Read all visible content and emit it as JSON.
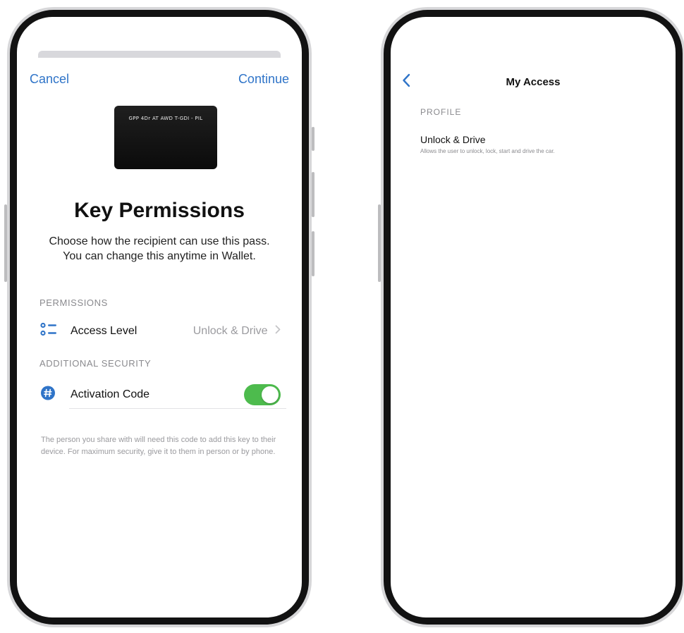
{
  "left_screen": {
    "nav": {
      "cancel_label": "Cancel",
      "continue_label": "Continue"
    },
    "card": {
      "text": "GPP 4Dr AT AWD T-GDI - PIL"
    },
    "title": "Key Permissions",
    "subtitle_line1": "Choose how the recipient can use this pass.",
    "subtitle_line2": "You can change this anytime in Wallet.",
    "permissions": {
      "section_label": "PERMISSIONS",
      "row_label": "Access Level",
      "row_value": "Unlock & Drive",
      "row_icon": "list-icon"
    },
    "security": {
      "section_label": "ADDITIONAL SECURITY",
      "row_label": "Activation Code",
      "row_icon": "hash-icon",
      "toggle_on": true
    },
    "footer": "The person you share with will need this code to add this key to their device. For maximum security, give it to them in person or by phone."
  },
  "right_screen": {
    "nav_title": "My Access",
    "back_icon": "chevron-left-icon",
    "section_label": "PROFILE",
    "item_title": "Unlock & Drive",
    "item_description": "Allows the user to unlock, lock, start and drive the car."
  },
  "colors": {
    "accent": "#2f74c8",
    "toggle_on": "#4dbb4d",
    "secondary_text": "#8a8a8e"
  }
}
